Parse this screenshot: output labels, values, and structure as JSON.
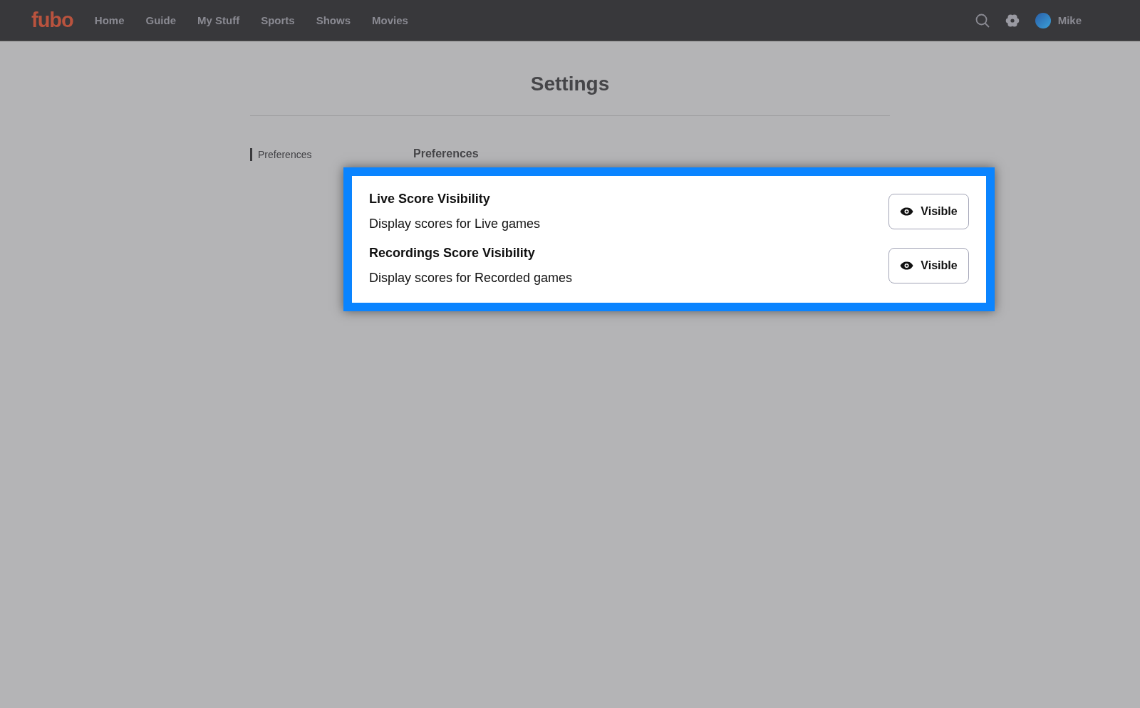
{
  "header": {
    "logo": "fubo",
    "nav": [
      "Home",
      "Guide",
      "My Stuff",
      "Sports",
      "Shows",
      "Movies"
    ],
    "user": {
      "name": "Mike"
    }
  },
  "page": {
    "title": "Settings"
  },
  "sidebar": {
    "items": [
      {
        "label": "Preferences",
        "selected": true
      }
    ]
  },
  "section": {
    "title": "Preferences",
    "settings": [
      {
        "title": "Live Score Visibility",
        "description": "Display scores for Live games",
        "button": "Visible"
      },
      {
        "title": "Recordings Score Visibility",
        "description": "Display scores for Recorded games",
        "button": "Visible"
      }
    ]
  }
}
